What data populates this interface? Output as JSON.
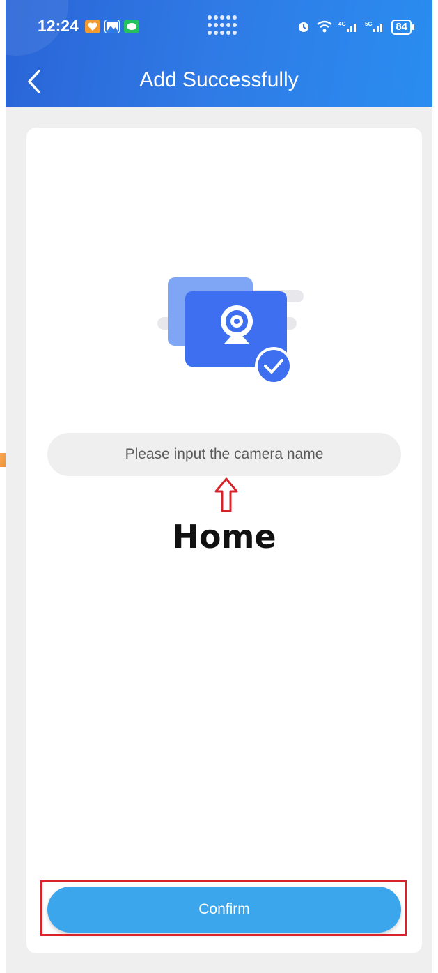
{
  "status_bar": {
    "time": "12:24",
    "battery": "84",
    "icons": [
      "heart-app-icon",
      "gallery-app-icon",
      "chat-app-icon",
      "alarm-icon",
      "wifi-icon",
      "signal-4g-icon",
      "signal-5g-icon"
    ]
  },
  "header": {
    "title": "Add Successfully",
    "back_icon": "chevron-left-icon"
  },
  "camera_name": {
    "placeholder": "Please input the camera name",
    "value": ""
  },
  "annotation": {
    "label": "Home"
  },
  "confirm_label": "Confirm",
  "colors": {
    "header_blue": "#2f7be6",
    "button_blue": "#3ba6ec",
    "annotation_red": "#d8232a",
    "arrow_orange": "#f08a2a"
  }
}
